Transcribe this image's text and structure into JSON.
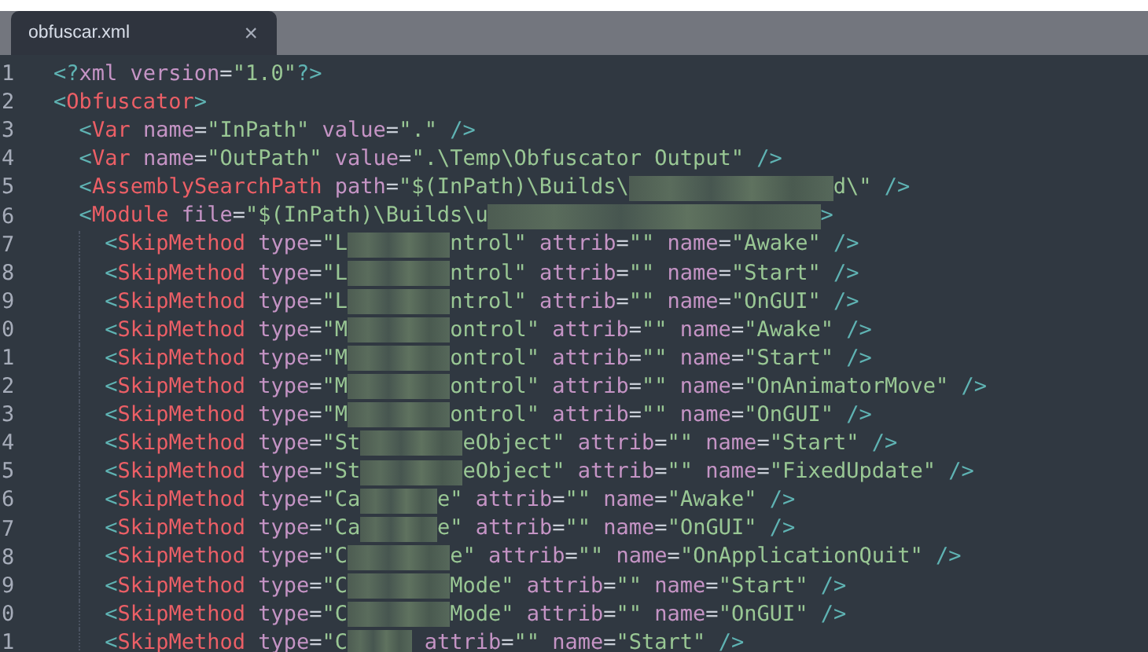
{
  "tab": {
    "title": "obfuscar.xml",
    "close": "×",
    "selected": true
  },
  "lines": [
    {
      "number": "1",
      "tokens": [
        {
          "kind": "punct",
          "text": "<?"
        },
        {
          "kind": "attr",
          "text": "xml version"
        },
        {
          "kind": "eq",
          "text": "="
        },
        {
          "kind": "str",
          "text": "\"1.0\""
        },
        {
          "kind": "punct",
          "text": "?>"
        }
      ]
    },
    {
      "number": "2",
      "tokens": [
        {
          "kind": "punct",
          "text": "<"
        },
        {
          "kind": "tag",
          "text": "Obfuscator"
        },
        {
          "kind": "punct",
          "text": ">"
        }
      ],
      "children": [
        {
          "number": "3",
          "tokens": [
            {
              "kind": "punct",
              "text": "<"
            },
            {
              "kind": "tag",
              "text": "Var"
            },
            {
              "kind": "attr",
              "text": " name"
            },
            {
              "kind": "eq",
              "text": "="
            },
            {
              "kind": "str",
              "text": "\"InPath\""
            },
            {
              "kind": "attr",
              "text": " value"
            },
            {
              "kind": "eq",
              "text": "="
            },
            {
              "kind": "str",
              "text": "\".\""
            },
            {
              "kind": "punct",
              "text": " />"
            }
          ]
        },
        {
          "number": "4",
          "tokens": [
            {
              "kind": "punct",
              "text": "<"
            },
            {
              "kind": "tag",
              "text": "Var"
            },
            {
              "kind": "attr",
              "text": " name"
            },
            {
              "kind": "eq",
              "text": "="
            },
            {
              "kind": "str",
              "text": "\"OutPath\""
            },
            {
              "kind": "attr",
              "text": " value"
            },
            {
              "kind": "eq",
              "text": "="
            },
            {
              "kind": "str",
              "text": "\".\\Temp\\Obfuscator Output\""
            },
            {
              "kind": "punct",
              "text": " />"
            }
          ]
        },
        {
          "number": "5",
          "tokens": [
            {
              "kind": "punct",
              "text": "<"
            },
            {
              "kind": "tag",
              "text": "AssemblySearchPath"
            },
            {
              "kind": "attr",
              "text": " path"
            },
            {
              "kind": "eq",
              "text": "="
            },
            {
              "kind": "str",
              "text": "\"$(InPath)\\Builds\\"
            },
            {
              "kind": "blurwide"
            },
            {
              "kind": "str",
              "text": "d\\\""
            },
            {
              "kind": "punct",
              "text": " />"
            }
          ]
        },
        {
          "number": "6",
          "tokens": [
            {
              "kind": "punct",
              "text": "<"
            },
            {
              "kind": "tag",
              "text": "Module"
            },
            {
              "kind": "attr",
              "text": " file"
            },
            {
              "kind": "eq",
              "text": "="
            },
            {
              "kind": "str",
              "text": "\"$(InPath)\\Builds\\u"
            },
            {
              "kind": "blurwider"
            },
            {
              "kind": "punct",
              "text": ">"
            }
          ],
          "children": [
            {
              "number": "7",
              "tokens": [
                {
                  "kind": "punct",
                  "text": "<"
                },
                {
                  "kind": "tag",
                  "text": "SkipMethod"
                },
                {
                  "kind": "attr",
                  "text": " type"
                },
                {
                  "kind": "eq",
                  "text": "="
                },
                {
                  "kind": "str",
                  "text": "\"L"
                },
                {
                  "kind": "blur"
                },
                {
                  "kind": "str",
                  "text": "ntrol\""
                },
                {
                  "kind": "attr",
                  "text": " attrib"
                },
                {
                  "kind": "eq",
                  "text": "="
                },
                {
                  "kind": "str",
                  "text": "\"\""
                },
                {
                  "kind": "attr",
                  "text": " name"
                },
                {
                  "kind": "eq",
                  "text": "="
                },
                {
                  "kind": "str",
                  "text": "\"Awake\""
                },
                {
                  "kind": "punct",
                  "text": " />"
                }
              ]
            },
            {
              "number": "8",
              "tokens": [
                {
                  "kind": "punct",
                  "text": "<"
                },
                {
                  "kind": "tag",
                  "text": "SkipMethod"
                },
                {
                  "kind": "attr",
                  "text": " type"
                },
                {
                  "kind": "eq",
                  "text": "="
                },
                {
                  "kind": "str",
                  "text": "\"L"
                },
                {
                  "kind": "blur"
                },
                {
                  "kind": "str",
                  "text": "ntrol\""
                },
                {
                  "kind": "attr",
                  "text": " attrib"
                },
                {
                  "kind": "eq",
                  "text": "="
                },
                {
                  "kind": "str",
                  "text": "\"\""
                },
                {
                  "kind": "attr",
                  "text": " name"
                },
                {
                  "kind": "eq",
                  "text": "="
                },
                {
                  "kind": "str",
                  "text": "\"Start\""
                },
                {
                  "kind": "punct",
                  "text": " />"
                }
              ]
            },
            {
              "number": "9",
              "tokens": [
                {
                  "kind": "punct",
                  "text": "<"
                },
                {
                  "kind": "tag",
                  "text": "SkipMethod"
                },
                {
                  "kind": "attr",
                  "text": " type"
                },
                {
                  "kind": "eq",
                  "text": "="
                },
                {
                  "kind": "str",
                  "text": "\"L"
                },
                {
                  "kind": "blur"
                },
                {
                  "kind": "str",
                  "text": "ntrol\""
                },
                {
                  "kind": "attr",
                  "text": " attrib"
                },
                {
                  "kind": "eq",
                  "text": "="
                },
                {
                  "kind": "str",
                  "text": "\"\""
                },
                {
                  "kind": "attr",
                  "text": " name"
                },
                {
                  "kind": "eq",
                  "text": "="
                },
                {
                  "kind": "str",
                  "text": "\"OnGUI\""
                },
                {
                  "kind": "punct",
                  "text": " />"
                }
              ]
            },
            {
              "number": "0",
              "tokens": [
                {
                  "kind": "punct",
                  "text": "<"
                },
                {
                  "kind": "tag",
                  "text": "SkipMethod"
                },
                {
                  "kind": "attr",
                  "text": " type"
                },
                {
                  "kind": "eq",
                  "text": "="
                },
                {
                  "kind": "str",
                  "text": "\"M"
                },
                {
                  "kind": "blur"
                },
                {
                  "kind": "str",
                  "text": "ontrol\""
                },
                {
                  "kind": "attr",
                  "text": " attrib"
                },
                {
                  "kind": "eq",
                  "text": "="
                },
                {
                  "kind": "str",
                  "text": "\"\""
                },
                {
                  "kind": "attr",
                  "text": " name"
                },
                {
                  "kind": "eq",
                  "text": "="
                },
                {
                  "kind": "str",
                  "text": "\"Awake\""
                },
                {
                  "kind": "punct",
                  "text": " />"
                }
              ]
            },
            {
              "number": "1",
              "tokens": [
                {
                  "kind": "punct",
                  "text": "<"
                },
                {
                  "kind": "tag",
                  "text": "SkipMethod"
                },
                {
                  "kind": "attr",
                  "text": " type"
                },
                {
                  "kind": "eq",
                  "text": "="
                },
                {
                  "kind": "str",
                  "text": "\"M"
                },
                {
                  "kind": "blur"
                },
                {
                  "kind": "str",
                  "text": "ontrol\""
                },
                {
                  "kind": "attr",
                  "text": " attrib"
                },
                {
                  "kind": "eq",
                  "text": "="
                },
                {
                  "kind": "str",
                  "text": "\"\""
                },
                {
                  "kind": "attr",
                  "text": " name"
                },
                {
                  "kind": "eq",
                  "text": "="
                },
                {
                  "kind": "str",
                  "text": "\"Start\""
                },
                {
                  "kind": "punct",
                  "text": " />"
                }
              ]
            },
            {
              "number": "2",
              "tokens": [
                {
                  "kind": "punct",
                  "text": "<"
                },
                {
                  "kind": "tag",
                  "text": "SkipMethod"
                },
                {
                  "kind": "attr",
                  "text": " type"
                },
                {
                  "kind": "eq",
                  "text": "="
                },
                {
                  "kind": "str",
                  "text": "\"M"
                },
                {
                  "kind": "blur"
                },
                {
                  "kind": "str",
                  "text": "ontrol\""
                },
                {
                  "kind": "attr",
                  "text": " attrib"
                },
                {
                  "kind": "eq",
                  "text": "="
                },
                {
                  "kind": "str",
                  "text": "\"\""
                },
                {
                  "kind": "attr",
                  "text": " name"
                },
                {
                  "kind": "eq",
                  "text": "="
                },
                {
                  "kind": "str",
                  "text": "\"OnAnimatorMove\""
                },
                {
                  "kind": "punct",
                  "text": " />"
                }
              ]
            },
            {
              "number": "3",
              "tokens": [
                {
                  "kind": "punct",
                  "text": "<"
                },
                {
                  "kind": "tag",
                  "text": "SkipMethod"
                },
                {
                  "kind": "attr",
                  "text": " type"
                },
                {
                  "kind": "eq",
                  "text": "="
                },
                {
                  "kind": "str",
                  "text": "\"M"
                },
                {
                  "kind": "blur"
                },
                {
                  "kind": "str",
                  "text": "ontrol\""
                },
                {
                  "kind": "attr",
                  "text": " attrib"
                },
                {
                  "kind": "eq",
                  "text": "="
                },
                {
                  "kind": "str",
                  "text": "\"\""
                },
                {
                  "kind": "attr",
                  "text": " name"
                },
                {
                  "kind": "eq",
                  "text": "="
                },
                {
                  "kind": "str",
                  "text": "\"OnGUI\""
                },
                {
                  "kind": "punct",
                  "text": " />"
                }
              ]
            },
            {
              "number": "4",
              "tokens": [
                {
                  "kind": "punct",
                  "text": "<"
                },
                {
                  "kind": "tag",
                  "text": "SkipMethod"
                },
                {
                  "kind": "attr",
                  "text": " type"
                },
                {
                  "kind": "eq",
                  "text": "="
                },
                {
                  "kind": "str",
                  "text": "\"St"
                },
                {
                  "kind": "blur"
                },
                {
                  "kind": "str",
                  "text": "eObject\""
                },
                {
                  "kind": "attr",
                  "text": " attrib"
                },
                {
                  "kind": "eq",
                  "text": "="
                },
                {
                  "kind": "str",
                  "text": "\"\""
                },
                {
                  "kind": "attr",
                  "text": " name"
                },
                {
                  "kind": "eq",
                  "text": "="
                },
                {
                  "kind": "str",
                  "text": "\"Start\""
                },
                {
                  "kind": "punct",
                  "text": " />"
                }
              ]
            },
            {
              "number": "5",
              "tokens": [
                {
                  "kind": "punct",
                  "text": "<"
                },
                {
                  "kind": "tag",
                  "text": "SkipMethod"
                },
                {
                  "kind": "attr",
                  "text": " type"
                },
                {
                  "kind": "eq",
                  "text": "="
                },
                {
                  "kind": "str",
                  "text": "\"St"
                },
                {
                  "kind": "blur"
                },
                {
                  "kind": "str",
                  "text": "eObject\""
                },
                {
                  "kind": "attr",
                  "text": " attrib"
                },
                {
                  "kind": "eq",
                  "text": "="
                },
                {
                  "kind": "str",
                  "text": "\"\""
                },
                {
                  "kind": "attr",
                  "text": " name"
                },
                {
                  "kind": "eq",
                  "text": "="
                },
                {
                  "kind": "str",
                  "text": "\"FixedUpdate\""
                },
                {
                  "kind": "punct",
                  "text": " />"
                }
              ]
            },
            {
              "number": "6",
              "tokens": [
                {
                  "kind": "punct",
                  "text": "<"
                },
                {
                  "kind": "tag",
                  "text": "SkipMethod"
                },
                {
                  "kind": "attr",
                  "text": " type"
                },
                {
                  "kind": "eq",
                  "text": "="
                },
                {
                  "kind": "str",
                  "text": "\"Ca"
                },
                {
                  "kind": "blurmid"
                },
                {
                  "kind": "str",
                  "text": "e\""
                },
                {
                  "kind": "attr",
                  "text": " attrib"
                },
                {
                  "kind": "eq",
                  "text": "="
                },
                {
                  "kind": "str",
                  "text": "\"\""
                },
                {
                  "kind": "attr",
                  "text": " name"
                },
                {
                  "kind": "eq",
                  "text": "="
                },
                {
                  "kind": "str",
                  "text": "\"Awake\""
                },
                {
                  "kind": "punct",
                  "text": " />"
                }
              ]
            },
            {
              "number": "7",
              "tokens": [
                {
                  "kind": "punct",
                  "text": "<"
                },
                {
                  "kind": "tag",
                  "text": "SkipMethod"
                },
                {
                  "kind": "attr",
                  "text": " type"
                },
                {
                  "kind": "eq",
                  "text": "="
                },
                {
                  "kind": "str",
                  "text": "\"Ca"
                },
                {
                  "kind": "blurmid"
                },
                {
                  "kind": "str",
                  "text": "e\""
                },
                {
                  "kind": "attr",
                  "text": " attrib"
                },
                {
                  "kind": "eq",
                  "text": "="
                },
                {
                  "kind": "str",
                  "text": "\"\""
                },
                {
                  "kind": "attr",
                  "text": " name"
                },
                {
                  "kind": "eq",
                  "text": "="
                },
                {
                  "kind": "str",
                  "text": "\"OnGUI\""
                },
                {
                  "kind": "punct",
                  "text": " />"
                }
              ]
            },
            {
              "number": "8",
              "tokens": [
                {
                  "kind": "punct",
                  "text": "<"
                },
                {
                  "kind": "tag",
                  "text": "SkipMethod"
                },
                {
                  "kind": "attr",
                  "text": " type"
                },
                {
                  "kind": "eq",
                  "text": "="
                },
                {
                  "kind": "str",
                  "text": "\"C"
                },
                {
                  "kind": "blur"
                },
                {
                  "kind": "str",
                  "text": "e\""
                },
                {
                  "kind": "attr",
                  "text": " attrib"
                },
                {
                  "kind": "eq",
                  "text": "="
                },
                {
                  "kind": "str",
                  "text": "\"\""
                },
                {
                  "kind": "attr",
                  "text": " name"
                },
                {
                  "kind": "eq",
                  "text": "="
                },
                {
                  "kind": "str",
                  "text": "\"OnApplicationQuit\""
                },
                {
                  "kind": "punct",
                  "text": " />"
                }
              ]
            },
            {
              "number": "9",
              "tokens": [
                {
                  "kind": "punct",
                  "text": "<"
                },
                {
                  "kind": "tag",
                  "text": "SkipMethod"
                },
                {
                  "kind": "attr",
                  "text": " type"
                },
                {
                  "kind": "eq",
                  "text": "="
                },
                {
                  "kind": "str",
                  "text": "\"C"
                },
                {
                  "kind": "blur"
                },
                {
                  "kind": "str",
                  "text": "Mode\""
                },
                {
                  "kind": "attr",
                  "text": " attrib"
                },
                {
                  "kind": "eq",
                  "text": "="
                },
                {
                  "kind": "str",
                  "text": "\"\""
                },
                {
                  "kind": "attr",
                  "text": " name"
                },
                {
                  "kind": "eq",
                  "text": "="
                },
                {
                  "kind": "str",
                  "text": "\"Start\""
                },
                {
                  "kind": "punct",
                  "text": " />"
                }
              ]
            },
            {
              "number": "0",
              "tokens": [
                {
                  "kind": "punct",
                  "text": "<"
                },
                {
                  "kind": "tag",
                  "text": "SkipMethod"
                },
                {
                  "kind": "attr",
                  "text": " type"
                },
                {
                  "kind": "eq",
                  "text": "="
                },
                {
                  "kind": "str",
                  "text": "\"C"
                },
                {
                  "kind": "blur"
                },
                {
                  "kind": "str",
                  "text": "Mode\""
                },
                {
                  "kind": "attr",
                  "text": " attrib"
                },
                {
                  "kind": "eq",
                  "text": "="
                },
                {
                  "kind": "str",
                  "text": "\"\""
                },
                {
                  "kind": "attr",
                  "text": " name"
                },
                {
                  "kind": "eq",
                  "text": "="
                },
                {
                  "kind": "str",
                  "text": "\"OnGUI\""
                },
                {
                  "kind": "punct",
                  "text": " />"
                }
              ]
            },
            {
              "number": "1",
              "tokens": [
                {
                  "kind": "punct",
                  "text": "<"
                },
                {
                  "kind": "tag",
                  "text": "SkipMethod"
                },
                {
                  "kind": "attr",
                  "text": " type"
                },
                {
                  "kind": "eq",
                  "text": "="
                },
                {
                  "kind": "str",
                  "text": "\"C"
                },
                {
                  "kind": "blurshort"
                },
                {
                  "kind": "attr",
                  "text": " attrib"
                },
                {
                  "kind": "eq",
                  "text": "="
                },
                {
                  "kind": "str",
                  "text": "\"\""
                },
                {
                  "kind": "attr",
                  "text": " name"
                },
                {
                  "kind": "eq",
                  "text": "="
                },
                {
                  "kind": "str",
                  "text": "\"Start\""
                },
                {
                  "kind": "punct",
                  "text": " />"
                }
              ]
            }
          ]
        }
      ]
    }
  ]
}
